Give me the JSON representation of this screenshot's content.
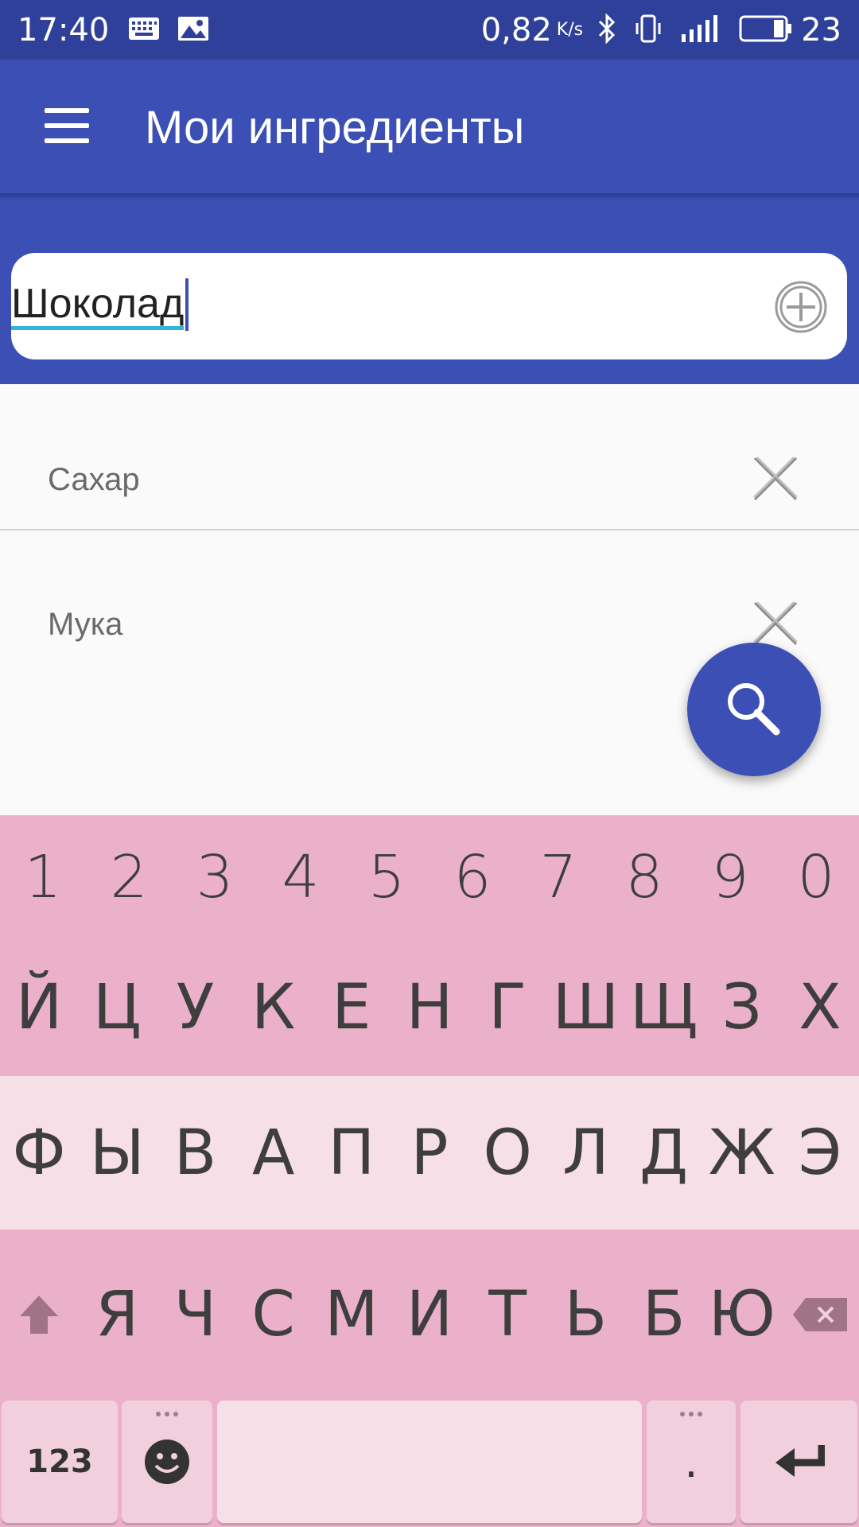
{
  "status_bar": {
    "time": "17:40",
    "net_speed": "0,82",
    "net_unit": "K/s",
    "battery_level": "23",
    "icons": [
      "keyboard-icon",
      "image-icon",
      "bluetooth-icon",
      "vibrate-icon",
      "signal-icon",
      "battery-icon"
    ]
  },
  "app_bar": {
    "title": "Мои ингредиенты",
    "menu_icon": "hamburger-menu-icon"
  },
  "ingredient_input": {
    "value": "Шоколад",
    "add_icon": "add-circle-icon"
  },
  "ingredients": [
    {
      "label": "Сахар",
      "remove_icon": "close-icon"
    },
    {
      "label": "Мука",
      "remove_icon": "close-icon"
    }
  ],
  "fab": {
    "icon": "search-icon"
  },
  "keyboard": {
    "number_row": [
      "1",
      "2",
      "3",
      "4",
      "5",
      "6",
      "7",
      "8",
      "9",
      "0"
    ],
    "row1": [
      "Й",
      "Ц",
      "У",
      "К",
      "Е",
      "Н",
      "Г",
      "Ш",
      "Щ",
      "З",
      "Х"
    ],
    "row2": [
      "Ф",
      "Ы",
      "В",
      "А",
      "П",
      "Р",
      "О",
      "Л",
      "Д",
      "Ж",
      "Э"
    ],
    "row3": [
      "Я",
      "Ч",
      "С",
      "М",
      "И",
      "Т",
      "Ь",
      "Б",
      "Ю"
    ],
    "bottom": {
      "numbers_label": "123",
      "dot_label": "."
    }
  },
  "colors": {
    "primary": "#3b4fb5",
    "status_bar": "#2f409a",
    "accent": "#33b5d6",
    "keyboard_pink": "#ebb1cb",
    "keyboard_light": "#f7dfe8"
  }
}
